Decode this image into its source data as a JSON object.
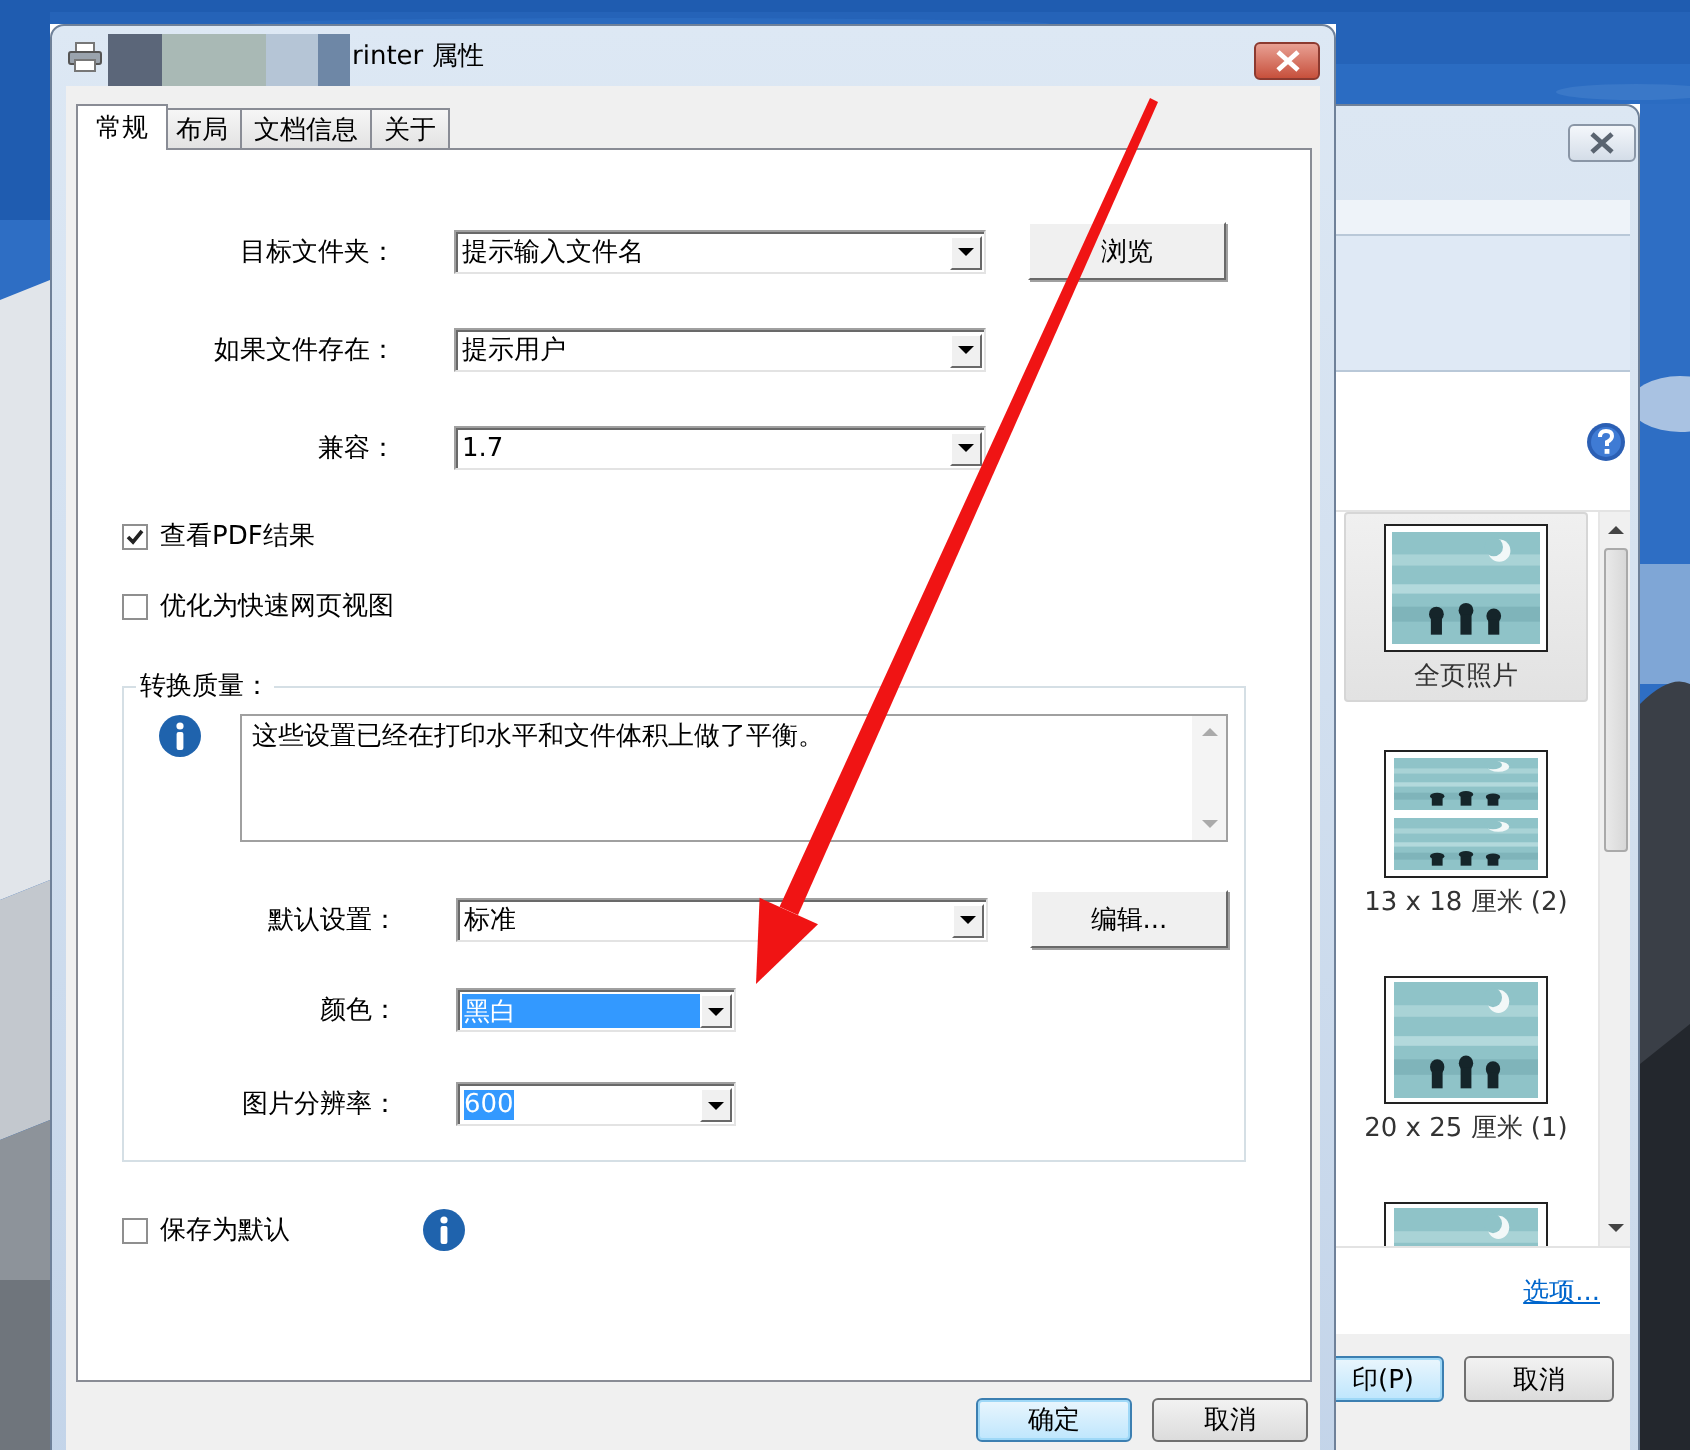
{
  "dialog": {
    "title": "rinter 属性",
    "tabs": [
      {
        "label": "常规",
        "selected": true
      },
      {
        "label": "布局",
        "selected": false
      },
      {
        "label": "文档信息",
        "selected": false
      },
      {
        "label": "关于",
        "selected": false
      }
    ],
    "fields": [
      {
        "label": "目标文件夹：",
        "value": "提示输入文件名"
      },
      {
        "label": "如果文件存在：",
        "value": "提示用户"
      },
      {
        "label": "兼容：",
        "value": "1.7"
      }
    ],
    "browse_button": "浏览",
    "checkboxes": [
      {
        "label": "查看PDF结果",
        "checked": true
      },
      {
        "label": "优化为快速网页视图",
        "checked": false
      }
    ],
    "quality_group": {
      "title": "转换质量：",
      "description": "这些设置已经在打印水平和文件体积上做了平衡。",
      "fields": [
        {
          "label": "默认设置：",
          "value": "标准",
          "selected": false,
          "kind": "wide"
        },
        {
          "label": "颜色：",
          "value": "黑白",
          "selected": true,
          "kind": "list"
        },
        {
          "label": "图片分辨率：",
          "value": "600",
          "selected": true,
          "kind": "combo"
        }
      ],
      "edit_button": "编辑..."
    },
    "save_default": {
      "label": "保存为默认",
      "checked": false
    },
    "buttons": [
      {
        "label": "确定",
        "default": true
      },
      {
        "label": "取消",
        "default": false
      }
    ]
  },
  "print_window": {
    "layouts": [
      {
        "label": "全页照片",
        "kind": "full",
        "selected": true
      },
      {
        "label": "13 x 18 厘米 (2)",
        "kind": "double",
        "selected": false
      },
      {
        "label": "20 x 25 厘米 (1)",
        "kind": "single",
        "selected": false
      },
      {
        "kind": "single",
        "selected": false
      }
    ],
    "options_link": "选项...",
    "buttons": [
      {
        "label": "印(P)",
        "default": true
      },
      {
        "label": "取消",
        "default": false
      }
    ]
  }
}
